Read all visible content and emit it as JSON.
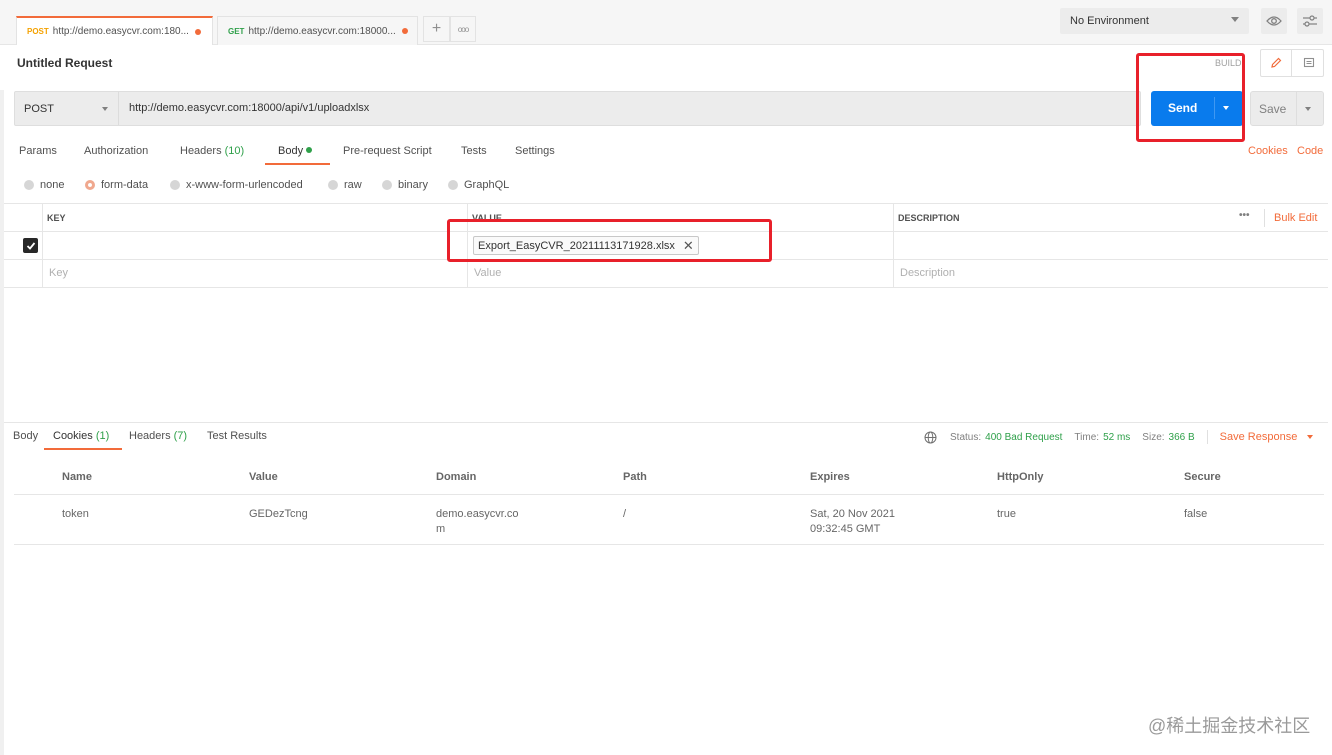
{
  "tabs": [
    {
      "method": "POST",
      "url": "http://demo.easycvr.com:180..."
    },
    {
      "method": "GET",
      "url": "http://demo.easycvr.com:18000..."
    }
  ],
  "tab_actions": {
    "add": "+",
    "more": "ooo"
  },
  "environment": {
    "selected": "No Environment"
  },
  "request": {
    "title": "Untitled Request",
    "build_label": "BUILD",
    "method": "POST",
    "url": "http://demo.easycvr.com:18000/api/v1/uploadxlsx",
    "send_label": "Send",
    "save_label": "Save"
  },
  "request_tabs": [
    {
      "label": "Params"
    },
    {
      "label": "Authorization"
    },
    {
      "label": "Headers",
      "count": "(10)"
    },
    {
      "label": "Body",
      "active": true
    },
    {
      "label": "Pre-request Script"
    },
    {
      "label": "Tests"
    },
    {
      "label": "Settings"
    }
  ],
  "request_links": {
    "cookies": "Cookies",
    "code": "Code"
  },
  "body_types": [
    "none",
    "form-data",
    "x-www-form-urlencoded",
    "raw",
    "binary",
    "GraphQL"
  ],
  "body_type_selected": "form-data",
  "form_table": {
    "headers": {
      "key": "KEY",
      "value": "VALUE",
      "description": "DESCRIPTION",
      "more": "•••",
      "bulk_edit": "Bulk Edit"
    },
    "rows": [
      {
        "checked": true,
        "key": "",
        "value": "Export_EasyCVR_20211113171928.xlsx",
        "description": ""
      }
    ],
    "placeholders": {
      "key": "Key",
      "value": "Value",
      "description": "Description"
    }
  },
  "response_tabs": [
    {
      "label": "Body"
    },
    {
      "label": "Cookies",
      "count": "(1)",
      "active": true
    },
    {
      "label": "Headers",
      "count": "(7)"
    },
    {
      "label": "Test Results"
    }
  ],
  "response_status": {
    "status_label": "Status:",
    "status": "400 Bad Request",
    "time_label": "Time:",
    "time": "52 ms",
    "size_label": "Size:",
    "size": "366 B",
    "save_response": "Save Response"
  },
  "cookies_table": {
    "columns": [
      "Name",
      "Value",
      "Domain",
      "Path",
      "Expires",
      "HttpOnly",
      "Secure"
    ],
    "rows": [
      {
        "name": "token",
        "value": "GEDezTcng",
        "domain_line1": "demo.easycvr.co",
        "domain_line2": "m",
        "path": "/",
        "expires_line1": "Sat, 20 Nov 2021",
        "expires_line2": "09:32:45 GMT",
        "httponly": "true",
        "secure": "false"
      }
    ]
  },
  "watermark": "@稀土掘金技术社区",
  "colors": {
    "accent": "#f26b3a",
    "send": "#097bed",
    "success": "#2fa04a",
    "highlight": "#e8202a"
  }
}
